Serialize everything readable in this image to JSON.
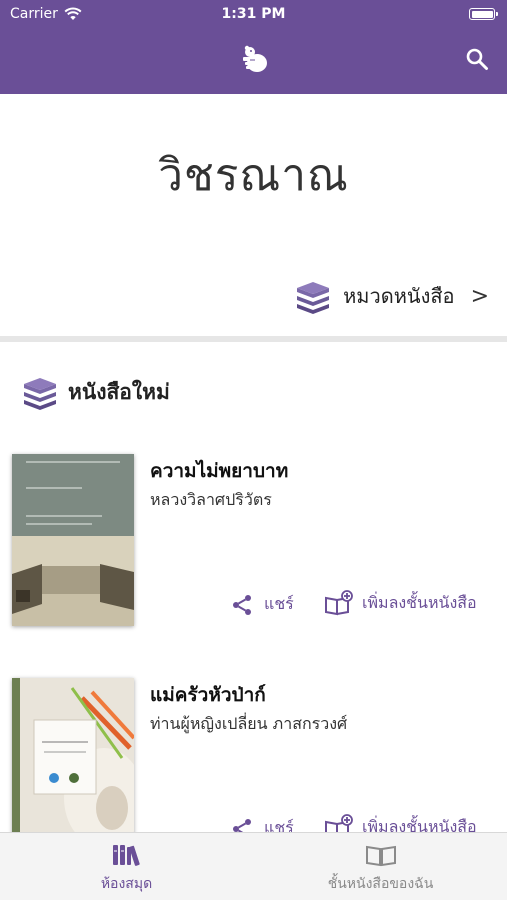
{
  "status_bar": {
    "carrier": "Carrier",
    "time": "1:31 PM"
  },
  "nav": {
    "logo_icon": "bear-logo-icon",
    "search_icon": "search-icon"
  },
  "hero": {
    "title": "วิชรณาณ"
  },
  "categories": {
    "label": "หมวดหนังสือ",
    "chevron": ">"
  },
  "new_books": {
    "title": "หนังสือใหม่",
    "items": [
      {
        "title": "ความไม่พยาบาท",
        "author": "หลวงวิลาศปริวัตร",
        "share_label": "แชร์",
        "add_label": "เพิ่มลงชั้นหนังสือ"
      },
      {
        "title": "แม่ครัวหัวป่าก์",
        "author": "ท่านผู้หญิงเปลี่ยน ภาสกรวงศ์",
        "share_label": "แชร์",
        "add_label": "เพิ่มลงชั้นหนังสือ"
      }
    ]
  },
  "tabs": [
    {
      "label": "ห้องสมุด",
      "active": true
    },
    {
      "label": "ชั้นหนังสือของฉัน",
      "active": false
    }
  ],
  "colors": {
    "accent": "#6a4f97",
    "tab_inactive": "#8a8a8a",
    "separator": "#e6e6e6"
  }
}
